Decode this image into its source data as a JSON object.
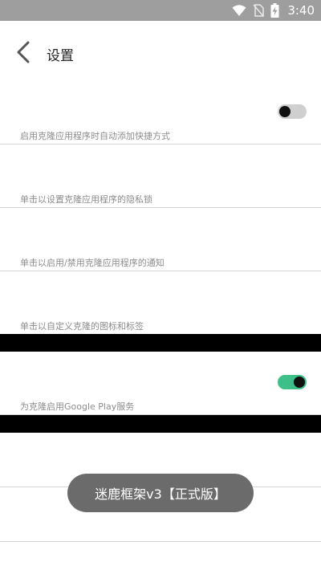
{
  "status_bar": {
    "time": "3:40",
    "icons": [
      "wifi-icon",
      "no-sim-icon",
      "battery-charging-icon"
    ]
  },
  "toolbar": {
    "title": "设置",
    "back_icon": "chevron-left-icon"
  },
  "settings": [
    {
      "subtitle": "启用克隆应用程序时自动添加快捷方式",
      "toggle": false
    },
    {
      "subtitle": "单击以设置克隆应用程序的隐私锁"
    },
    {
      "subtitle": "单击以启用/禁用克隆应用程序的通知"
    },
    {
      "subtitle": "单击以自定义克隆的图标和标签"
    },
    {
      "subtitle": "为克隆启用Google Play服务",
      "toggle": true
    }
  ],
  "toast": {
    "text": "迷鹿框架v3【正式版】"
  },
  "colors": {
    "status_bar": "#9e9e9e",
    "toggle_on": "#3dbf8a",
    "toggle_off": "#cfcfcf",
    "toast_bg": "#6b6b6b",
    "divider": "#d6d6d6"
  }
}
